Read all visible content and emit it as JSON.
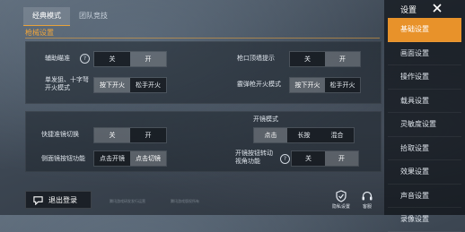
{
  "tabs": [
    {
      "label": "经典模式",
      "active": true
    },
    {
      "label": "团队竞技",
      "active": false
    }
  ],
  "section_title": "枪械设置",
  "settings": {
    "aim_assist": {
      "label": "辅助瞄准",
      "help": "?",
      "options": [
        "关",
        "开"
      ],
      "selected": "开"
    },
    "single_burst": {
      "label": "单发狙、十字弩开火模式",
      "options": [
        "按下开火",
        "松手开火"
      ],
      "selected": "按下开火"
    },
    "muzzle_hint": {
      "label": "枪口顶墙提示",
      "options": [
        "关",
        "开"
      ],
      "selected": "开"
    },
    "shotgun_fire": {
      "label": "霰弹枪开火模式",
      "options": [
        "按下开火",
        "松手开火"
      ],
      "selected": "按下开火"
    },
    "quick_scope": {
      "label": "快捷准镜切换",
      "options": [
        "关",
        "开"
      ],
      "selected": "关"
    },
    "side_scope": {
      "label": "侧面镜按钮功能",
      "options": [
        "点击开镜",
        "点击切镜"
      ],
      "selected": "点击切镜"
    },
    "scope_mode": {
      "label": "开镜模式",
      "options": [
        "点击",
        "长按",
        "混合"
      ],
      "selected": "点击"
    },
    "scope_turn": {
      "label": "开镜按钮转动视角功能",
      "help": "?",
      "options": [
        "关",
        "开"
      ],
      "selected": "开"
    }
  },
  "logout": {
    "label": "退出登录"
  },
  "copyright": [
    "腾讯游戏研发发行运营",
    "腾讯游戏版权所有"
  ],
  "utils": [
    {
      "label": "隐私设置",
      "icon": "shield-icon"
    },
    {
      "label": "客服",
      "icon": "headset-icon"
    }
  ],
  "sidebar": {
    "title": "设置",
    "items": [
      {
        "label": "基础设置",
        "active": true
      },
      {
        "label": "画面设置",
        "active": false
      },
      {
        "label": "操作设置",
        "active": false
      },
      {
        "label": "载具设置",
        "active": false
      },
      {
        "label": "灵敏度设置",
        "active": false
      },
      {
        "label": "拾取设置",
        "active": false
      },
      {
        "label": "效果设置",
        "active": false
      },
      {
        "label": "声音设置",
        "active": false
      },
      {
        "label": "录像设置",
        "active": false
      }
    ]
  },
  "colors": {
    "accent": "#e8922a",
    "section": "#f0a53b"
  }
}
